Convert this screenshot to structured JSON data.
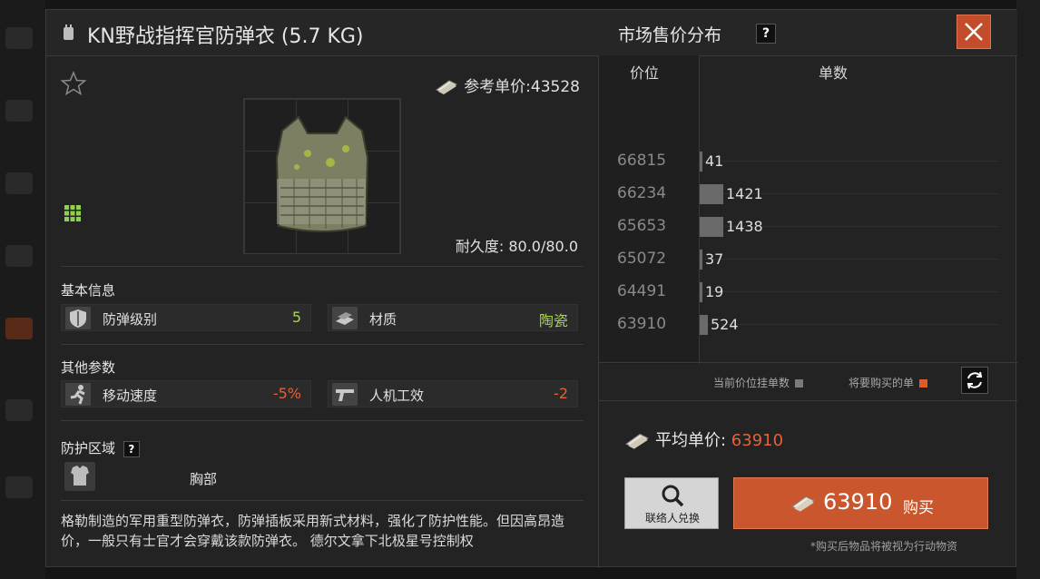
{
  "item": {
    "title": "KN野战指挥官防弹衣 (5.7 KG)",
    "ref_price_label": "参考单价:43528",
    "durability_label": "耐久度:",
    "durability_value": "80.0/80.0"
  },
  "basic": {
    "heading": "基本信息",
    "stats": [
      {
        "label": "防弹级别",
        "value": "5",
        "icon": "shield-icon"
      },
      {
        "label": "材质",
        "value": "陶瓷",
        "icon": "material-icon"
      }
    ]
  },
  "other": {
    "heading": "其他参数",
    "stats": [
      {
        "label": "移动速度",
        "value": "-5%",
        "icon": "running-icon"
      },
      {
        "label": "人机工效",
        "value": "-2",
        "icon": "pistol-icon"
      }
    ]
  },
  "zone": {
    "heading": "防护区域",
    "help": "?",
    "value": "胸部"
  },
  "description": "格勒制造的军用重型防弹衣，防弹插板采用新式材料，强化了防护性能。但因高昂造价，一般只有士官才会穿戴该款防弹衣。 德尔文拿下北极星号控制权",
  "market": {
    "title": "市场售价分布",
    "help": "?",
    "col_price": "价位",
    "col_count": "单数",
    "legend_current": "当前价位挂单数",
    "legend_buy": "将要购买的单",
    "avg_label": "平均单价: ",
    "avg_value": "63910",
    "contact_label": "联络人兑换",
    "buy_price": "63910",
    "buy_label": "购买",
    "note": "*购买后物品将被视为行动物资"
  },
  "colors": {
    "accent": "#c9562d",
    "positive": "#a6d44f",
    "negative": "#e2623a",
    "bar": "#6a6a6a"
  },
  "chart_data": {
    "type": "bar",
    "orientation": "horizontal",
    "price_ticks": [
      "66815",
      "66234",
      "65653",
      "65072",
      "64491",
      "63910"
    ],
    "values": [
      41,
      1421,
      1438,
      37,
      19,
      524
    ],
    "xlabel": "单数",
    "ylabel": "价位"
  }
}
